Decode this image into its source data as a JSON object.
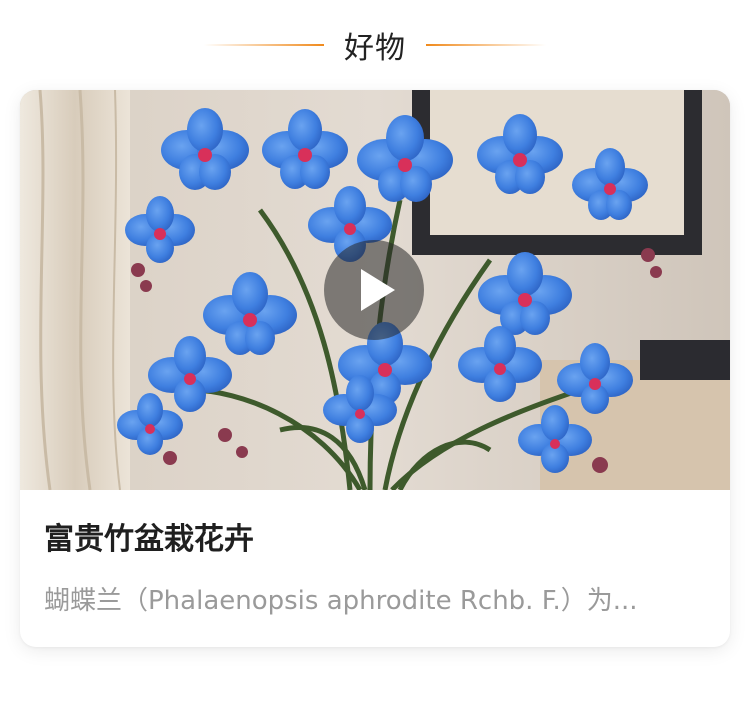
{
  "section": {
    "title": "好物"
  },
  "card": {
    "title": "富贵竹盆栽花卉",
    "description": "蝴蝶兰（Phalaenopsis aphrodite Rchb. F.）为...",
    "media": {
      "icon": "play-icon"
    }
  },
  "colors": {
    "accent": "#f08a1c",
    "title_text": "#1f1f1f",
    "desc_text": "#9a9a9a",
    "orchid_blue": "#3f7fe0",
    "orchid_center": "#d8305a"
  }
}
